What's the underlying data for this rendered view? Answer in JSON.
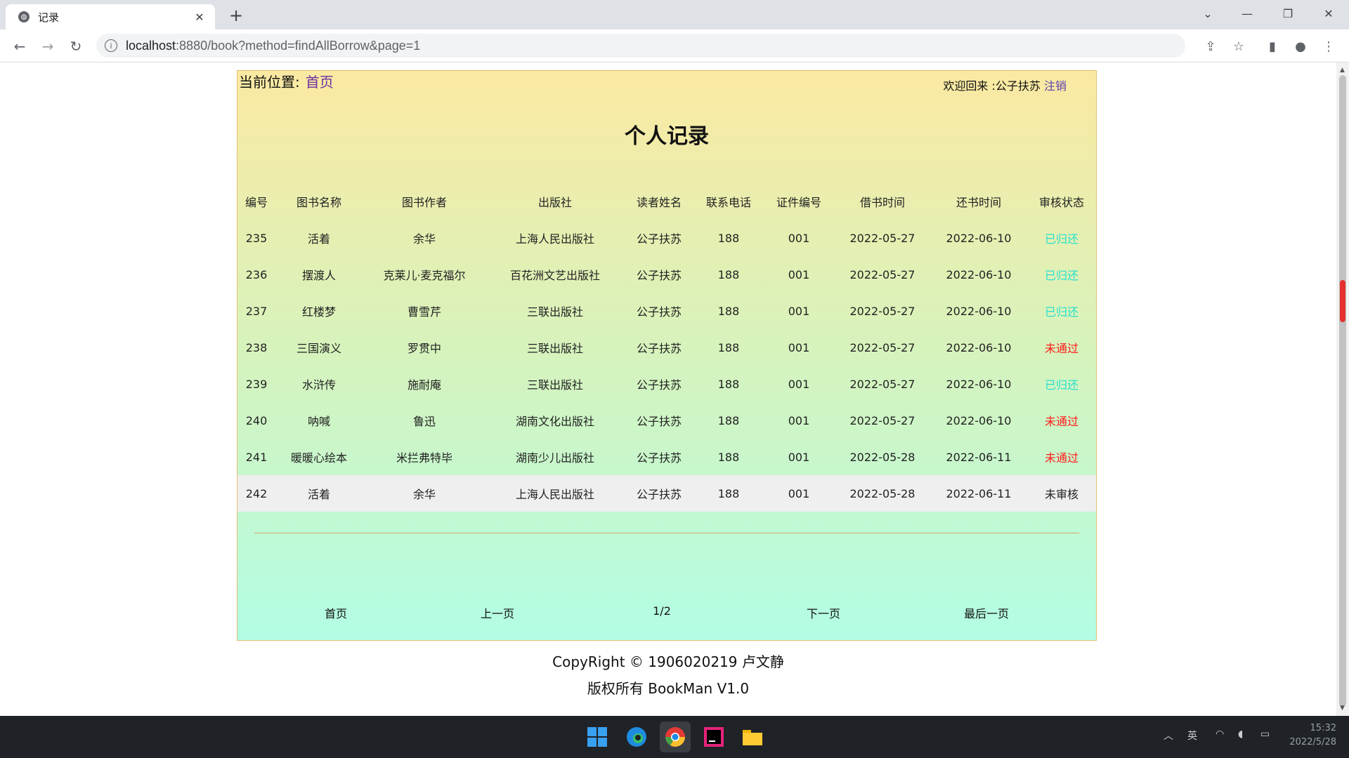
{
  "browser": {
    "tab_title": "记录",
    "tab_close": "✕",
    "new_tab": "+",
    "url_host": "localhost",
    "url_rest": ":8880/book?method=findAllBorrow&page=1"
  },
  "page": {
    "location_label": "当前位置:",
    "location_link": "首页",
    "welcome_text": "欢迎回来 :公子扶苏",
    "logout_link": "注销",
    "title": "个人记录"
  },
  "table": {
    "headers": [
      "编号",
      "图书名称",
      "图书作者",
      "出版社",
      "读者姓名",
      "联系电话",
      "证件编号",
      "借书时间",
      "还书时间",
      "审核状态"
    ],
    "rows": [
      [
        "235",
        "活着",
        "余华",
        "上海人民出版社",
        "公子扶苏",
        "188",
        "001",
        "2022-05-27",
        "2022-06-10",
        "已归还"
      ],
      [
        "236",
        "摆渡人",
        "克莱儿·麦克福尔",
        "百花洲文艺出版社",
        "公子扶苏",
        "188",
        "001",
        "2022-05-27",
        "2022-06-10",
        "已归还"
      ],
      [
        "237",
        "红楼梦",
        "曹雪芹",
        "三联出版社",
        "公子扶苏",
        "188",
        "001",
        "2022-05-27",
        "2022-06-10",
        "已归还"
      ],
      [
        "238",
        "三国演义",
        "罗贯中",
        "三联出版社",
        "公子扶苏",
        "188",
        "001",
        "2022-05-27",
        "2022-06-10",
        "未通过"
      ],
      [
        "239",
        "水浒传",
        "施耐庵",
        "三联出版社",
        "公子扶苏",
        "188",
        "001",
        "2022-05-27",
        "2022-06-10",
        "已归还"
      ],
      [
        "240",
        "呐喊",
        "鲁迅",
        "湖南文化出版社",
        "公子扶苏",
        "188",
        "001",
        "2022-05-27",
        "2022-06-10",
        "未通过"
      ],
      [
        "241",
        "暖暖心绘本",
        "米拦弗特毕",
        "湖南少儿出版社",
        "公子扶苏",
        "188",
        "001",
        "2022-05-28",
        "2022-06-11",
        "未通过"
      ],
      [
        "242",
        "活着",
        "余华",
        "上海人民出版社",
        "公子扶苏",
        "188",
        "001",
        "2022-05-28",
        "2022-06-11",
        "未审核"
      ]
    ]
  },
  "pager": {
    "first": "首页",
    "prev": "上一页",
    "current": "1/2",
    "next": "下一页",
    "last": "最后一页"
  },
  "footer": {
    "line1": "CopyRight © 1906020219 卢文静",
    "line2": "版权所有 BookMan V1.0"
  },
  "taskbar": {
    "ime": "英",
    "time": "15:32",
    "date": "2022/5/28"
  },
  "colors": {
    "returned": "#25e0d0",
    "rejected": "#ff1a1a",
    "pending": "#222222"
  }
}
